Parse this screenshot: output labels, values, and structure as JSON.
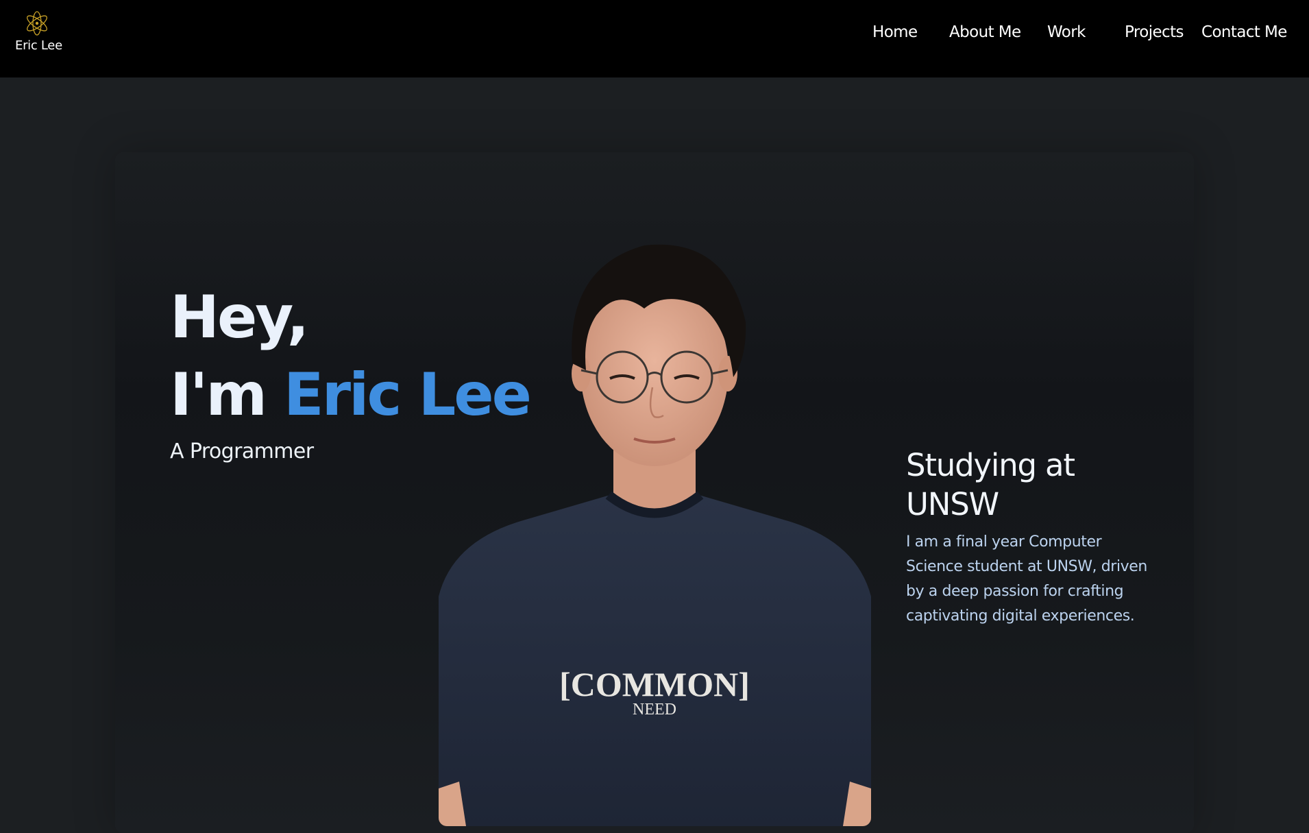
{
  "nav": {
    "brand": {
      "name": "Eric Lee",
      "logo_icon": "atom-icon",
      "logo_color": "#c9a227"
    },
    "links": [
      "Home",
      "About Me",
      "Work",
      "Projects",
      "Contact Me"
    ]
  },
  "hero": {
    "greeting": "Hey,",
    "intro_prefix": "I'm ",
    "name": "Eric Lee",
    "role": "A Programmer",
    "portrait": {
      "shirt_text_line1": "[COMMON]",
      "shirt_text_line2": "NEED"
    },
    "study": {
      "title": "Studying at UNSW",
      "description": "I am a final year Computer Science student at UNSW, driven by a deep passion for crafting captivating digital experiences."
    }
  },
  "colors": {
    "nav_background": "#000000",
    "page_background": "#1c1f22",
    "accent": "#3f8ee0",
    "heading_text": "#eaf1fb",
    "body_text": "#bcd3ef"
  }
}
